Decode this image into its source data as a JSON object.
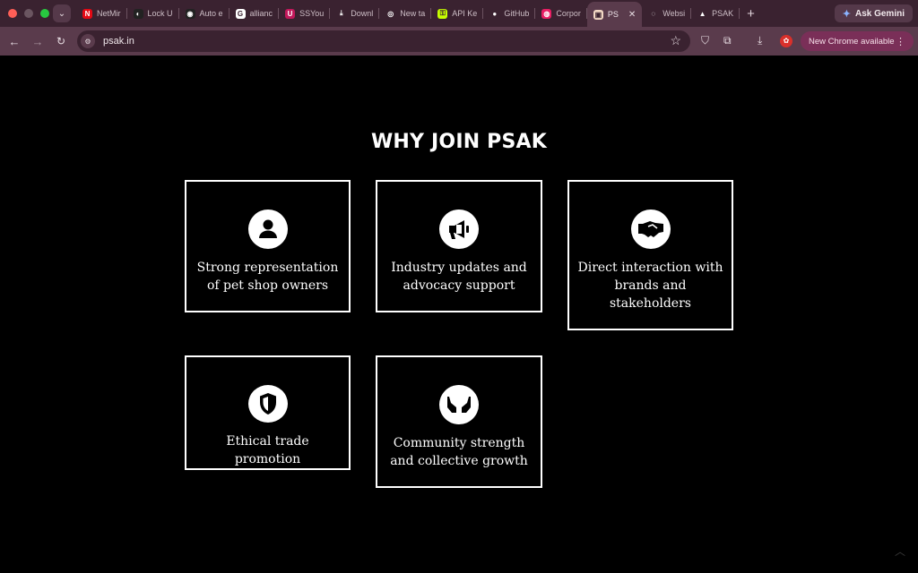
{
  "browser": {
    "tabs": [
      {
        "title": "NetMir",
        "icon": "netflix-icon",
        "color": "#e50914"
      },
      {
        "title": "Lock U",
        "icon": "lock-app-icon",
        "color": "#222222"
      },
      {
        "title": "Auto e",
        "icon": "auto-icon",
        "color": "#222222"
      },
      {
        "title": "allianc",
        "icon": "google-icon",
        "color": "#ffffff"
      },
      {
        "title": "SSYou",
        "icon": "ssyoutube-icon",
        "color": "#c2185b"
      },
      {
        "title": "Downl",
        "icon": "download-icon",
        "color": "#3a2230"
      },
      {
        "title": "New ta",
        "icon": "chrome-icon",
        "color": "#3a2230"
      },
      {
        "title": "API Ke",
        "icon": "api-key-icon",
        "color": "#c6ff00"
      },
      {
        "title": "GitHub",
        "icon": "github-icon",
        "color": "#3a2230"
      },
      {
        "title": "Corpor",
        "icon": "corporate-icon",
        "color": "#e91e63"
      },
      {
        "title": "PS",
        "icon": "psak-favicon-icon",
        "color": "#f3d9c5",
        "active": true
      },
      {
        "title": "Websi",
        "icon": "website-icon",
        "color": "#3a2230"
      },
      {
        "title": "PSAK",
        "icon": "psak-triangle-icon",
        "color": "#3a2230"
      }
    ],
    "new_tab_symbol": "+",
    "gemini_label": "Ask Gemini",
    "url": "psak.in",
    "update_label": "New Chrome available"
  },
  "page": {
    "heading": "WHY JOIN PSAK",
    "cards": [
      {
        "label": "Strong representation of pet shop owners",
        "icon": "user-icon"
      },
      {
        "label": "Industry updates and advocacy support",
        "icon": "megaphone-icon"
      },
      {
        "label": "Direct interaction with brands and stakeholders",
        "icon": "handshake-icon"
      },
      {
        "label": "Ethical trade promotion",
        "icon": "shield-icon"
      },
      {
        "label": "Community strength and collective growth",
        "icon": "hands-icon"
      }
    ]
  }
}
